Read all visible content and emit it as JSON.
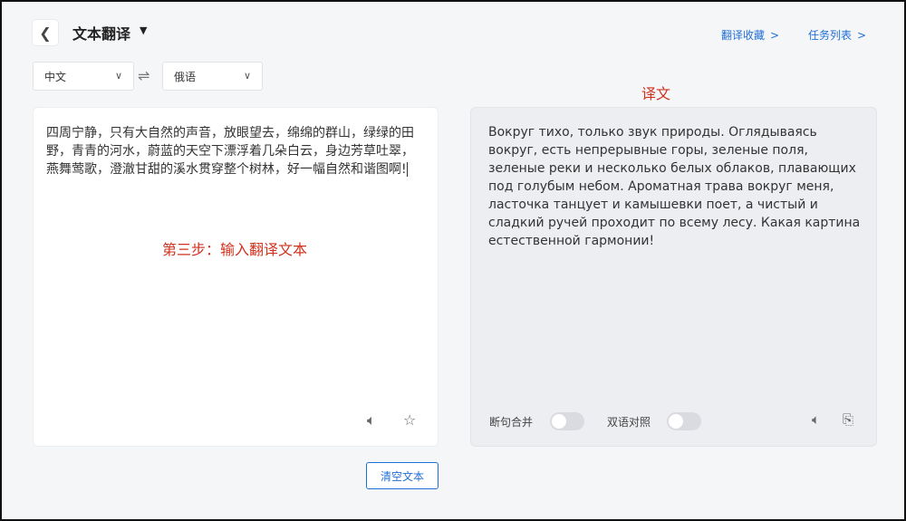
{
  "header": {
    "back_icon": "chevron-left-icon",
    "title": "文本翻译",
    "title_caret": "▼",
    "links": [
      {
        "label": "翻译收藏",
        "chev": ">"
      },
      {
        "label": "任务列表",
        "chev": ">"
      }
    ]
  },
  "languages": {
    "source": "中文",
    "target": "俄语",
    "swap_icon": "swap-arrows-icon"
  },
  "target_label": "译文",
  "source": {
    "text": "四周宁静，只有大自然的声音，放眼望去，绵绵的群山，绿绿的田野，青青的河水，蔚蓝的天空下漂浮着几朵白云，身边芳草吐翠，燕舞莺歌，澄澈甘甜的溪水贯穿整个树林，好一幅自然和谐图啊!",
    "step_hint": "第三步：输入翻译文本",
    "icons": [
      "speaker-icon",
      "star-icon"
    ]
  },
  "target": {
    "text": "Вокруг тихо, только звук природы. Оглядываясь вокруг, есть непрерывные горы, зеленые поля, зеленые реки и несколько белых облаков, плавающих под голубым небом. Ароматная трава вокруг меня, ласточка танцует и камышевки поет, а чистый и сладкий ручей проходит по всему лесу. Какая картина естественной гармонии!",
    "toggles": [
      {
        "label": "断句合并",
        "on": false
      },
      {
        "label": "双语对照",
        "on": false
      }
    ],
    "icons": [
      "speaker-icon",
      "copy-icon"
    ]
  },
  "clear_button": "清空文本"
}
